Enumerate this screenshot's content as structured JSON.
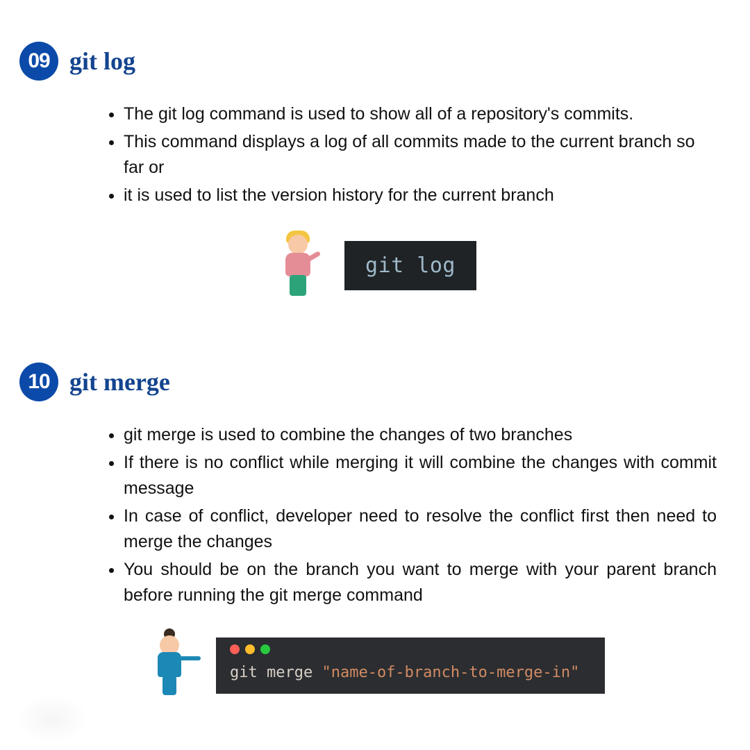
{
  "sections": [
    {
      "badge": "09",
      "title": "git log",
      "bullets": [
        "The git log command is used to show all of a repository's commits.",
        "This command displays a log of all commits made to the current branch so far or",
        "it is used to list the version history for the current branch"
      ],
      "terminal": {
        "style": "plain",
        "text": "git log"
      }
    },
    {
      "badge": "10",
      "title": "git merge",
      "bullets": [
        "git merge is used to combine the changes of two branches",
        "If there is no conflict while merging it will combine the changes with commit message",
        "In case of conflict, developer need to resolve the conflict first then need to merge the changes",
        "You should be on the branch you want to merge with your parent branch before running the git merge command"
      ],
      "terminal": {
        "style": "mac",
        "cmd": "git merge",
        "arg": "\"name-of-branch-to-merge-in\""
      }
    }
  ]
}
